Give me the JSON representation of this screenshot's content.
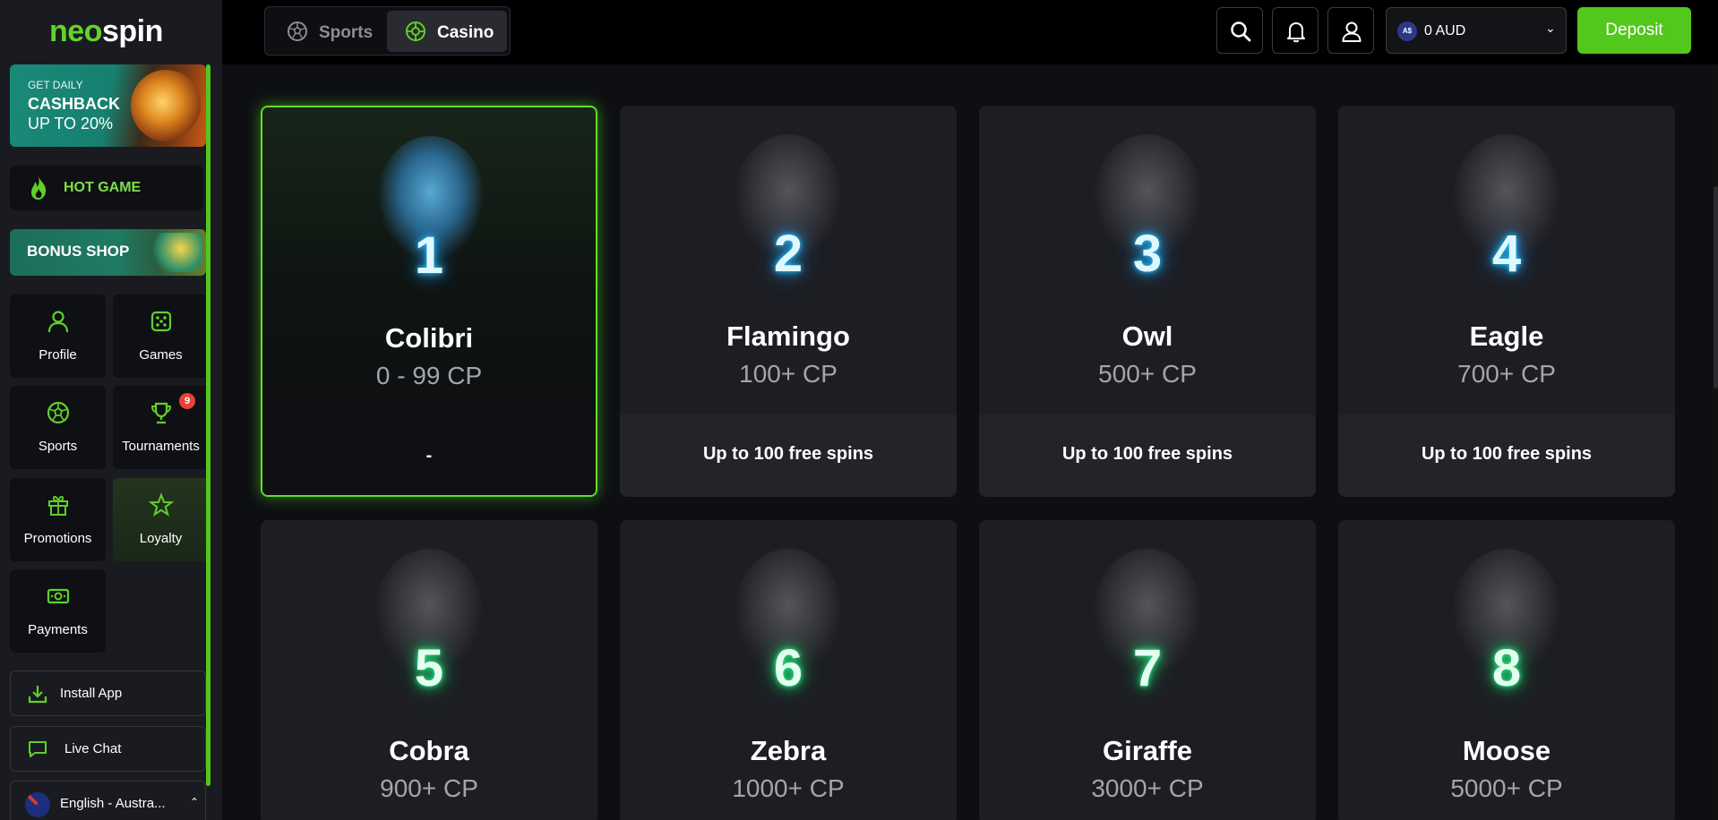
{
  "brand": {
    "part1": "neo",
    "part2": "spin"
  },
  "sidebar": {
    "cashback": {
      "line1": "GET DAILY",
      "line2": "CASHBACK",
      "line3": "UP TO 20%"
    },
    "hot_game": "HOT GAME",
    "bonus_shop": "BONUS SHOP",
    "tiles": [
      {
        "label": "Profile",
        "icon": "person-icon"
      },
      {
        "label": "Games",
        "icon": "dice-icon"
      },
      {
        "label": "Sports",
        "icon": "soccer-ball-icon"
      },
      {
        "label": "Tournaments",
        "icon": "trophy-icon",
        "badge": "9"
      },
      {
        "label": "Promotions",
        "icon": "gift-icon"
      },
      {
        "label": "Loyalty",
        "icon": "star-icon",
        "active": true
      },
      {
        "label": "Payments",
        "icon": "cash-icon"
      }
    ],
    "install_app": "Install App",
    "live_chat": "Live Chat",
    "language": "English - Austra..."
  },
  "header": {
    "tabs": [
      {
        "label": "Sports"
      },
      {
        "label": "Casino",
        "active": true
      }
    ],
    "currency_symbol": "A$",
    "balance": "0 AUD",
    "deposit": "Deposit"
  },
  "levels": [
    {
      "number": "1",
      "name": "Colibri",
      "cp": "0 - 99 CP",
      "reward": "-",
      "current": true
    },
    {
      "number": "2",
      "name": "Flamingo",
      "cp": "100+ CP",
      "reward": "Up to 100 free spins"
    },
    {
      "number": "3",
      "name": "Owl",
      "cp": "500+ CP",
      "reward": "Up to 100 free spins"
    },
    {
      "number": "4",
      "name": "Eagle",
      "cp": "700+ CP",
      "reward": "Up to 100 free spins"
    },
    {
      "number": "5",
      "name": "Cobra",
      "cp": "900+ CP"
    },
    {
      "number": "6",
      "name": "Zebra",
      "cp": "1000+ CP"
    },
    {
      "number": "7",
      "name": "Giraffe",
      "cp": "3000+ CP"
    },
    {
      "number": "8",
      "name": "Moose",
      "cp": "5000+ CP"
    }
  ],
  "colors": {
    "accent": "#52c71c",
    "neon_blue": "#29c4ff",
    "neon_green": "#2ef08a",
    "badge": "#e8403a"
  }
}
